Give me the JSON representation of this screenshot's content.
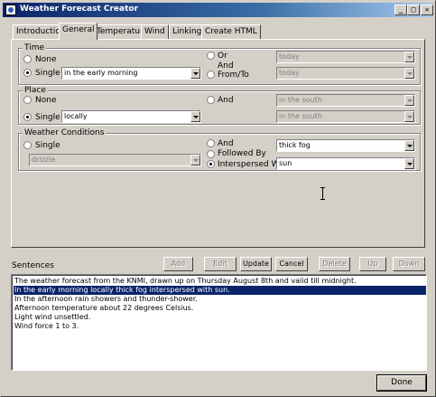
{
  "window": {
    "title": "Weather Forecast Creator",
    "min_glyph": "_",
    "max_glyph": "□",
    "close_glyph": "✕"
  },
  "tabs": [
    "Introduction",
    "General",
    "Temperature",
    "Wind",
    "Linking",
    "Create HTML"
  ],
  "active_tab": "General",
  "time": {
    "label": "Time",
    "none_label": "None",
    "single_label": "Single",
    "single_value": "in the early morning",
    "or_label": "Or",
    "or_value": "today",
    "and_label": "And",
    "fromto_label": "From/To",
    "fromto_value": "today",
    "selected": "Single"
  },
  "place": {
    "label": "Place",
    "none_label": "None",
    "single_label": "Single",
    "single_value": "locally",
    "and_label": "And",
    "and_value1": "in the south",
    "and_value2": "in the south",
    "selected": "Single"
  },
  "conditions": {
    "label": "Weather Conditions",
    "single_label": "Single",
    "single_value": "drizzle",
    "and_label": "And",
    "and_value": "thick fog",
    "followed_label": "Followed By",
    "interspersed_label": "Interspersed With",
    "interspersed_value": "sun",
    "selected": "Interspersed With"
  },
  "sentences": {
    "label": "Sentences",
    "buttons": {
      "add": "Add",
      "edit": "Edit",
      "update": "Update",
      "cancel": "Cancel",
      "delete": "Delete",
      "up": "Up",
      "down": "Down"
    },
    "items": [
      "The weather forecast from the KNMI, drawn up on Thursday August 8th and valid till midnight.",
      "In the early morning locally thick fog interspersed with sun.",
      "In the afternoon rain showers and thunder-shower.",
      "Afternoon temperature about 22 degrees Celsius.",
      "Light wind unsettled.",
      "Wind force 1 to 3."
    ],
    "selected_index": 1
  },
  "done_label": "Done"
}
